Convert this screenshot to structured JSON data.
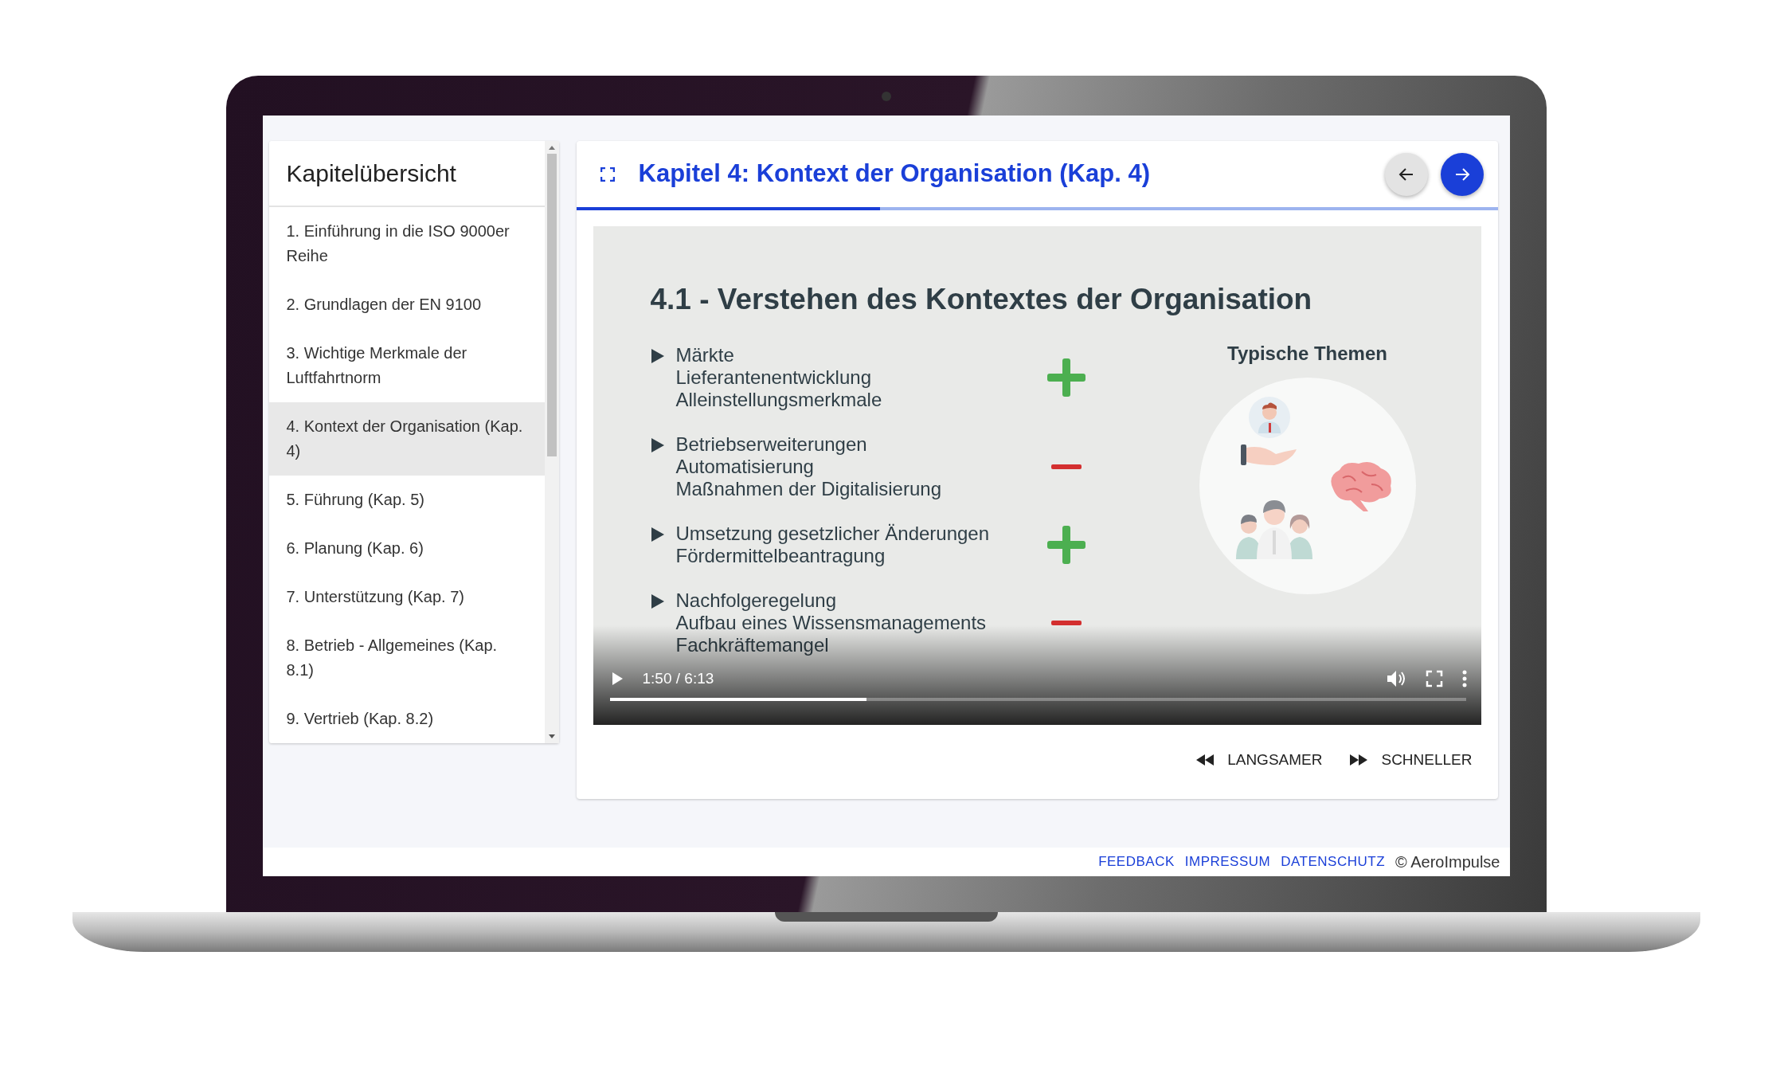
{
  "sidebar": {
    "title": "Kapitelübersicht",
    "items": [
      {
        "label": "1. Einführung in die ISO 9000er Reihe",
        "selected": false
      },
      {
        "label": "2. Grundlagen der EN 9100",
        "selected": false
      },
      {
        "label": "3. Wichtige Merkmale der Luftfahrtnorm",
        "selected": false
      },
      {
        "label": "4. Kontext der Organisation (Kap. 4)",
        "selected": true
      },
      {
        "label": "5. Führung (Kap. 5)",
        "selected": false
      },
      {
        "label": "6. Planung (Kap. 6)",
        "selected": false
      },
      {
        "label": "7. Unterstützung (Kap. 7)",
        "selected": false
      },
      {
        "label": "8. Betrieb - Allgemeines (Kap. 8.1)",
        "selected": false
      },
      {
        "label": "9. Vertrieb (Kap. 8.2)",
        "selected": false
      }
    ]
  },
  "chapter": {
    "title": "Kapitel 4: Kontext der Organisation (Kap. 4)",
    "level": 0.33
  },
  "video": {
    "slide": {
      "title": "4.1 - Verstehen des Kontextes der Organisation",
      "topics_title": "Typische Themen",
      "points": [
        {
          "lines": [
            "Märkte",
            "Lieferantenentwicklung",
            "Alleinstellungsmerkmale"
          ],
          "kind": "plus",
          "color": "#4caf50"
        },
        {
          "lines": [
            "Betriebserweiterungen",
            "Automatisierung",
            "Maßnahmen der Digitalisierung"
          ],
          "kind": "minus",
          "color": "#d32f2f"
        },
        {
          "lines": [
            "Umsetzung gesetzlicher Änderungen",
            "Fördermittelbeantragung"
          ],
          "kind": "plus",
          "color": "#4caf50"
        },
        {
          "lines": [
            "Nachfolgeregelung",
            "Aufbau eines Wissensmanagements",
            "Fachkräftemangel"
          ],
          "kind": "minus",
          "color": "#d32f2f"
        }
      ]
    },
    "time": "1:50 / 6:13",
    "level": 0.3
  },
  "speed_buttons": [
    {
      "label": "LANGSAMER",
      "kind": "slower"
    },
    {
      "label": "SCHNELLER",
      "kind": "faster"
    }
  ],
  "footer": {
    "links": [
      "FEEDBACK",
      "IMPRESSUM",
      "DATENSCHUTZ"
    ],
    "copyright": "© AeroImpulse"
  }
}
